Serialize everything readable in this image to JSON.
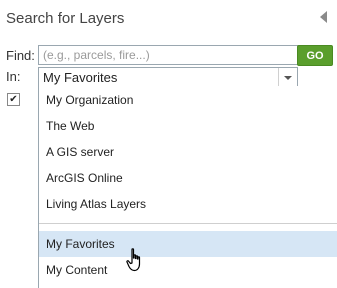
{
  "panel": {
    "title": "Search for Layers",
    "collapse_icon": "triangle-left-icon"
  },
  "find": {
    "label": "Find:",
    "placeholder": "(e.g., parcels, fire...)",
    "value": "",
    "go_label": "GO"
  },
  "in": {
    "label": "In:",
    "selected": "My Favorites"
  },
  "checkbox": {
    "checked": true,
    "icon": "checkmark-icon"
  },
  "dropdown": {
    "options": [
      "My Organization",
      "The Web",
      "A GIS server",
      "ArcGIS Online",
      "Living Atlas Layers",
      "My Favorites",
      "My Content"
    ],
    "hovered": "My Favorites"
  },
  "colors": {
    "go_button": "#5a9e2c",
    "hover_row": "#d6e6f5",
    "border": "#9aa7b0"
  },
  "cursor": "hand-pointer-icon"
}
